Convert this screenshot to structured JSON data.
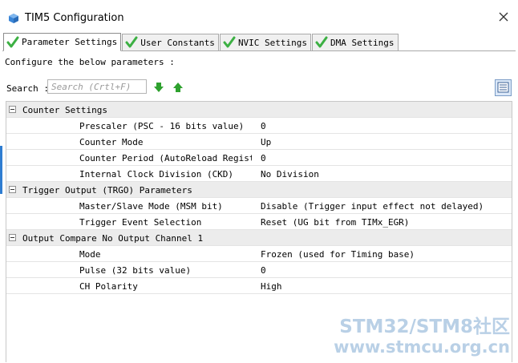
{
  "window": {
    "title": "TIM5 Configuration",
    "close_icon": "close-icon",
    "app_icon": "cube-icon"
  },
  "tabs": [
    {
      "label": "Parameter Settings",
      "active": true
    },
    {
      "label": "User Constants",
      "active": false
    },
    {
      "label": "NVIC Settings",
      "active": false
    },
    {
      "label": "DMA Settings",
      "active": false
    }
  ],
  "configure_label": "Configure the below parameters :",
  "search": {
    "label": "Search :",
    "placeholder": "Search (Crtl+F)"
  },
  "groups": [
    {
      "title": "Counter Settings",
      "params": [
        {
          "name": "Prescaler (PSC - 16 bits value)",
          "value": "0"
        },
        {
          "name": "Counter Mode",
          "value": "Up"
        },
        {
          "name": "Counter Period (AutoReload Registe...",
          "value": "0"
        },
        {
          "name": "Internal Clock Division (CKD)",
          "value": "No Division"
        }
      ]
    },
    {
      "title": "Trigger Output (TRGO) Parameters",
      "params": [
        {
          "name": "Master/Slave Mode (MSM bit)",
          "value": "Disable (Trigger input effect not delayed)"
        },
        {
          "name": "Trigger Event Selection",
          "value": "Reset (UG bit from TIMx_EGR)"
        }
      ]
    },
    {
      "title": "Output Compare No Output Channel 1",
      "params": [
        {
          "name": "Mode",
          "value": "Frozen (used for Timing base)"
        },
        {
          "name": "Pulse (32 bits value)",
          "value": "0"
        },
        {
          "name": "CH Polarity",
          "value": "High"
        }
      ]
    }
  ],
  "watermark": {
    "line1": "STM32/STM8社区",
    "line2": "www.stmcu.org.cn"
  },
  "colors": {
    "check_green": "#3cb043",
    "arrow_green": "#2ea12e",
    "group_bg": "#ececec",
    "accent": "#2f7dd1"
  }
}
